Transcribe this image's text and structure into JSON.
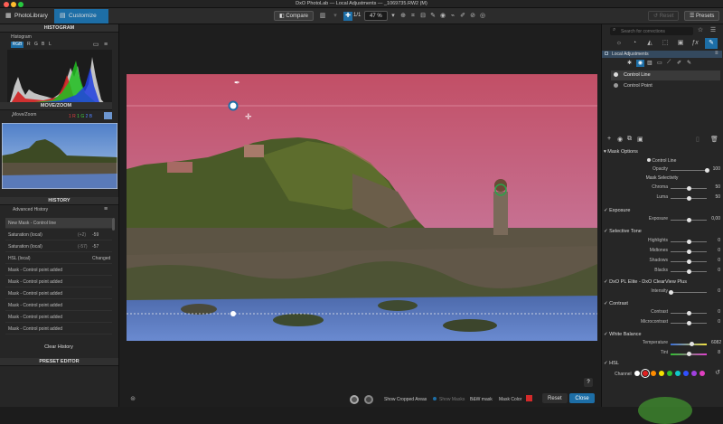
{
  "window": {
    "title": "DxO PhotoLab — Local Adjustments — _1069735.RW2 (M)"
  },
  "appbar": {
    "tab_library": "PhotoLibrary",
    "tab_customize": "Customize",
    "compare_label": "Compare",
    "ratio": "1/1",
    "zoom": "47 %",
    "reset_label": "Reset",
    "presets_label": "Presets"
  },
  "left": {
    "histogram_title": "HISTOGRAM",
    "histogram_label": "Histogram",
    "channels": [
      "RGB",
      "R",
      "G",
      "B",
      "L"
    ],
    "hist_readout": {
      "r": "1 R",
      "g": "1 G",
      "b": "2 B"
    },
    "movezoom_title": "MOVE/ZOOM",
    "movezoom_label": "Move/Zoom",
    "history_title": "HISTORY",
    "history_label": "Advanced History",
    "history": [
      {
        "name": "New Mask - Control line",
        "from": "",
        "to": ""
      },
      {
        "name": "Saturation (local)",
        "from": "(+2)",
        "to": "-59"
      },
      {
        "name": "Saturation (local)",
        "from": "(-57)",
        "to": "-57"
      },
      {
        "name": "HSL (local)",
        "from": "",
        "to": "Changed"
      },
      {
        "name": "Mask - Control point added",
        "from": "",
        "to": ""
      },
      {
        "name": "Mask - Control point added",
        "from": "",
        "to": ""
      },
      {
        "name": "Mask - Control point added",
        "from": "",
        "to": ""
      },
      {
        "name": "Mask - Control point added",
        "from": "",
        "to": ""
      },
      {
        "name": "Mask - Control point added",
        "from": "",
        "to": ""
      },
      {
        "name": "Mask - Control point added",
        "from": "",
        "to": ""
      }
    ],
    "clear_history": "Clear History",
    "preset_editor_title": "PRESET EDITOR"
  },
  "bottom": {
    "show_cropped": "Show Cropped Areas",
    "show_masks": "Show Masks",
    "bw_mask": "B&W mask",
    "mask_color_label": "Mask Color",
    "mask_color": "#d42a2a",
    "reset": "Reset",
    "close": "Close",
    "help": "?"
  },
  "right": {
    "search_placeholder": "Search for corrections",
    "local_adj_title": "Local Adjustments",
    "masks": [
      "Control Line",
      "Control Point"
    ],
    "mask_options_title": "Mask Options",
    "mask_options_mode": "Control Line",
    "mask_selectivity": "Mask Selectivity",
    "opacity": {
      "label": "Opacity",
      "value": "100"
    },
    "chroma": {
      "label": "Chroma",
      "value": "50"
    },
    "luma": {
      "label": "Luma",
      "value": "50"
    },
    "exposure_title": "Exposure",
    "exposure": {
      "label": "Exposure",
      "value": "0,00"
    },
    "selective_tone_title": "Selective Tone",
    "highlights": {
      "label": "Highlights",
      "value": "0"
    },
    "midtones": {
      "label": "Midtones",
      "value": "0"
    },
    "shadows": {
      "label": "Shadows",
      "value": "0"
    },
    "blacks": {
      "label": "Blacks",
      "value": "0"
    },
    "clearview_title": "DxO PL Elite - DxO ClearView Plus",
    "intensity": {
      "label": "Intensity",
      "value": "0"
    },
    "contrast_title": "Contrast",
    "contrast": {
      "label": "Contrast",
      "value": "0"
    },
    "microcontrast": {
      "label": "Microcontrast",
      "value": "0"
    },
    "wb_title": "White Balance",
    "temperature": {
      "label": "Temperature",
      "value": "6082"
    },
    "tint": {
      "label": "Tint",
      "value": "8"
    },
    "hsl_title": "HSL",
    "channel_label": "Channel",
    "channel_colors": [
      "#ffffff",
      "#e02020",
      "#ff8c00",
      "#f5e000",
      "#30c030",
      "#10c8c8",
      "#3050ff",
      "#a040e0",
      "#e040c0"
    ]
  },
  "levels": {
    "opacity": 1.0,
    "chroma": 0.5,
    "luma": 0.5,
    "exposure": 0.5,
    "tone": 0.5,
    "intensity": 0.0,
    "contrast": 0.5,
    "temperature": 0.58,
    "tint": 0.52
  }
}
